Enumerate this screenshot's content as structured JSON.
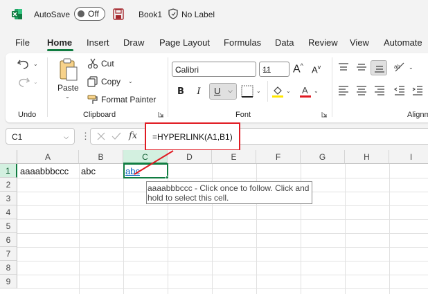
{
  "titlebar": {
    "autosave_label": "AutoSave",
    "autosave_state": "Off",
    "doc_title": "Book1",
    "sensitivity_label": "No Label"
  },
  "tabs": [
    "File",
    "Home",
    "Insert",
    "Draw",
    "Page Layout",
    "Formulas",
    "Data",
    "Review",
    "View",
    "Automate"
  ],
  "active_tab": "Home",
  "ribbon": {
    "undo_group_label": "Undo",
    "clipboard": {
      "paste_label": "Paste",
      "cut_label": "Cut",
      "copy_label": "Copy",
      "format_painter_label": "Format Painter",
      "group_label": "Clipboard"
    },
    "font": {
      "font_name": "Calibri",
      "font_size": "11",
      "bold": "B",
      "italic": "I",
      "underline": "U",
      "group_label": "Font"
    },
    "alignment_group_label": "Alignm"
  },
  "formula_bar": {
    "name_box": "C1",
    "fx_label": "fx",
    "formula": "=HYPERLINK(A1,B1)"
  },
  "grid": {
    "columns": [
      "A",
      "B",
      "C",
      "D",
      "E",
      "F",
      "G",
      "H",
      "I"
    ],
    "rows": [
      "1",
      "2",
      "3",
      "4",
      "5",
      "6",
      "7",
      "8",
      "9"
    ],
    "cells": {
      "A1": "aaaabbbccc",
      "B1": "abc",
      "C1": "abc"
    },
    "selected_cell": "C1"
  },
  "tooltip": {
    "line1": "aaaabbbccc - Click once to follow. Click and",
    "line2": "hold to select this cell."
  },
  "colors": {
    "excel_green": "#107c41",
    "highlight_red": "#e01a22",
    "hyperlink_blue": "#0563c1"
  }
}
